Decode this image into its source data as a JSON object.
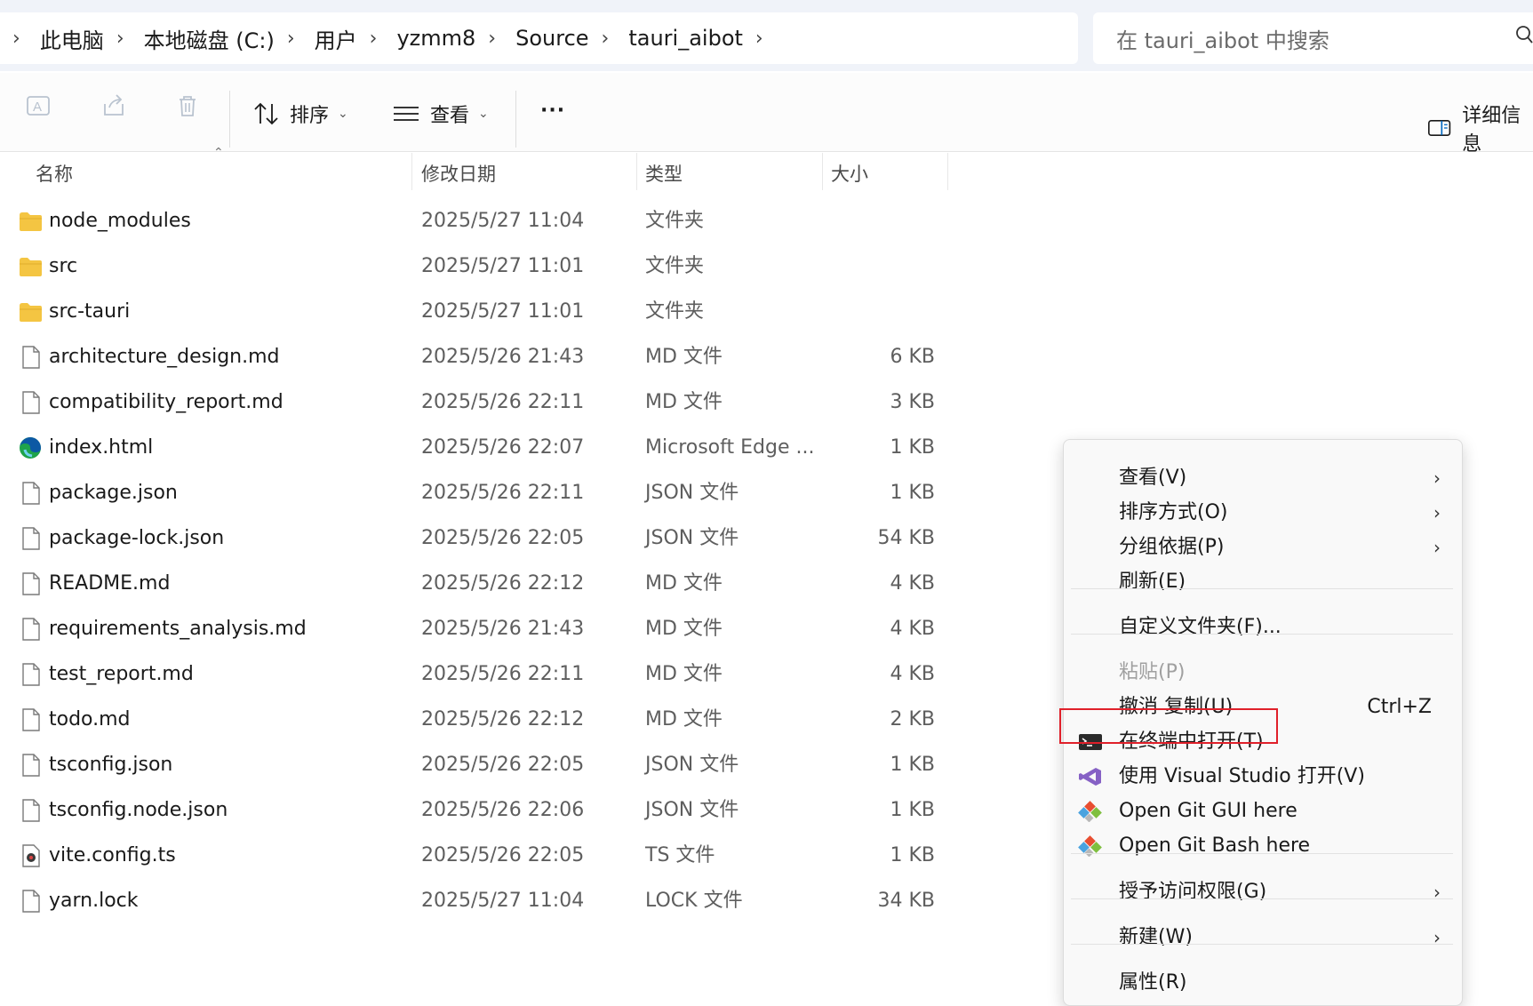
{
  "address": {
    "crumbs": [
      "此电脑",
      "本地磁盘 (C:)",
      "用户",
      "yzmm8",
      "Source",
      "tauri_aibot"
    ],
    "search_placeholder": "在 tauri_aibot 中搜索"
  },
  "toolbar": {
    "sort_label": "排序",
    "view_label": "查看",
    "more_label": "···",
    "details_label": "详细信息"
  },
  "columns": {
    "name": "名称",
    "date": "修改日期",
    "type": "类型",
    "size": "大小"
  },
  "files": [
    {
      "name": "node_modules",
      "date": "2025/5/27 11:04",
      "type": "文件夹",
      "size": "",
      "icon": "folder-icon"
    },
    {
      "name": "src",
      "date": "2025/5/27 11:01",
      "type": "文件夹",
      "size": "",
      "icon": "folder-icon"
    },
    {
      "name": "src-tauri",
      "date": "2025/5/27 11:01",
      "type": "文件夹",
      "size": "",
      "icon": "folder-icon"
    },
    {
      "name": "architecture_design.md",
      "date": "2025/5/26 21:43",
      "type": "MD 文件",
      "size": "6 KB",
      "icon": "file-icon"
    },
    {
      "name": "compatibility_report.md",
      "date": "2025/5/26 22:11",
      "type": "MD 文件",
      "size": "3 KB",
      "icon": "file-icon"
    },
    {
      "name": "index.html",
      "date": "2025/5/26 22:07",
      "type": "Microsoft Edge ...",
      "size": "1 KB",
      "icon": "edge-icon"
    },
    {
      "name": "package.json",
      "date": "2025/5/26 22:11",
      "type": "JSON 文件",
      "size": "1 KB",
      "icon": "file-icon"
    },
    {
      "name": "package-lock.json",
      "date": "2025/5/26 22:05",
      "type": "JSON 文件",
      "size": "54 KB",
      "icon": "file-icon"
    },
    {
      "name": "README.md",
      "date": "2025/5/26 22:12",
      "type": "MD 文件",
      "size": "4 KB",
      "icon": "file-icon"
    },
    {
      "name": "requirements_analysis.md",
      "date": "2025/5/26 21:43",
      "type": "MD 文件",
      "size": "4 KB",
      "icon": "file-icon"
    },
    {
      "name": "test_report.md",
      "date": "2025/5/26 22:11",
      "type": "MD 文件",
      "size": "4 KB",
      "icon": "file-icon"
    },
    {
      "name": "todo.md",
      "date": "2025/5/26 22:12",
      "type": "MD 文件",
      "size": "2 KB",
      "icon": "file-icon"
    },
    {
      "name": "tsconfig.json",
      "date": "2025/5/26 22:05",
      "type": "JSON 文件",
      "size": "1 KB",
      "icon": "file-icon"
    },
    {
      "name": "tsconfig.node.json",
      "date": "2025/5/26 22:06",
      "type": "JSON 文件",
      "size": "1 KB",
      "icon": "file-icon"
    },
    {
      "name": "vite.config.ts",
      "date": "2025/5/26 22:05",
      "type": "TS 文件",
      "size": "1 KB",
      "icon": "ts-file-icon"
    },
    {
      "name": "yarn.lock",
      "date": "2025/5/27 11:04",
      "type": "LOCK 文件",
      "size": "34 KB",
      "icon": "file-icon"
    }
  ],
  "context_menu": {
    "view": "查看(V)",
    "sort_by": "排序方式(O)",
    "group_by": "分组依据(P)",
    "refresh": "刷新(E)",
    "customize": "自定义文件夹(F)...",
    "paste": "粘贴(P)",
    "undo_copy": "撤消 复制(U)",
    "undo_shortcut": "Ctrl+Z",
    "open_terminal": "在终端中打开(T)",
    "open_vs": "使用 Visual Studio 打开(V)",
    "git_gui": "Open Git GUI here",
    "git_bash": "Open Git Bash here",
    "grant_access": "授予访问权限(G)",
    "new": "新建(W)",
    "properties": "属性(R)"
  },
  "colors": {
    "highlight_box": "#e0202a",
    "folder": "#f4c542",
    "accent": "#0067c0"
  }
}
